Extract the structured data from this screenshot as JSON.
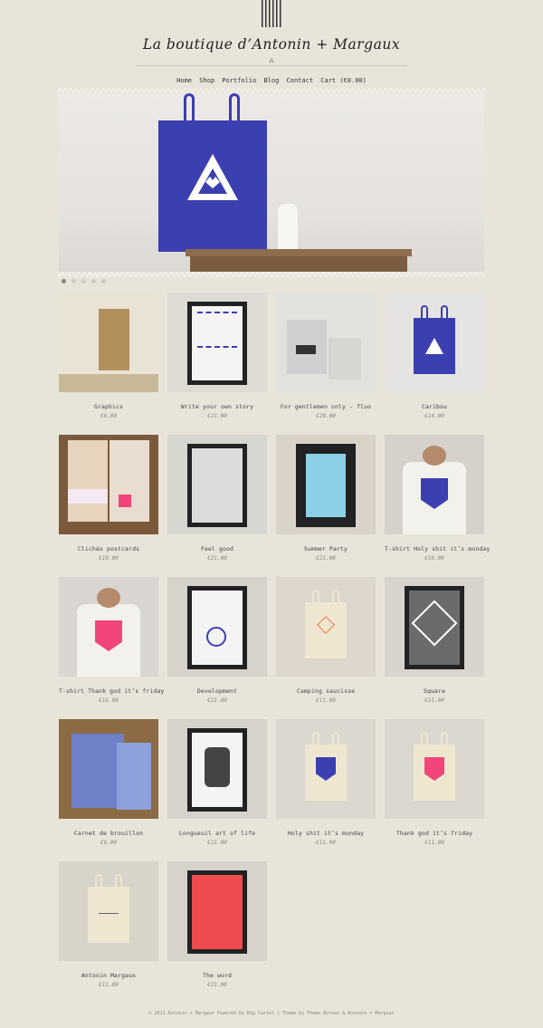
{
  "site": {
    "title": "La boutique d’Antonin + Margaux"
  },
  "nav": [
    {
      "label": "Home"
    },
    {
      "label": "Shop"
    },
    {
      "label": "Portfolio"
    },
    {
      "label": "Blog"
    },
    {
      "label": "Contact"
    },
    {
      "label": "Cart (€0.00)"
    }
  ],
  "slider": {
    "dot_count": 5,
    "active_index": 0
  },
  "products": [
    {
      "name": "Graphics",
      "price": "€6.00",
      "bg": "#e9e3d6"
    },
    {
      "name": "Write your own story",
      "price": "€21.00",
      "bg": "#dedbd4"
    },
    {
      "name": "For gentlemen only - fluo",
      "price": "€29.00",
      "bg": "#e3e1dd"
    },
    {
      "name": "Caribou",
      "price": "€14.00",
      "bg": "#e6e4e2"
    },
    {
      "name": "Clichés postcards",
      "price": "€10.00",
      "bg": "#7a5a3a"
    },
    {
      "name": "Feel good",
      "price": "€21.00",
      "bg": "#d8d6d0"
    },
    {
      "name": "Summer Party",
      "price": "€21.00",
      "bg": "#d9d3c8"
    },
    {
      "name": "T-shirt Holy shit it’s monday",
      "price": "€16.00",
      "bg": "#d6d2cb"
    },
    {
      "name": "T-shirt Thank god it’s friday",
      "price": "€16.00",
      "bg": "#d9d6d1"
    },
    {
      "name": "Development",
      "price": "€21.00",
      "bg": "#d7d2ca"
    },
    {
      "name": "Camping saucisse",
      "price": "€11.00",
      "bg": "#dcd6cc"
    },
    {
      "name": "Square",
      "price": "€21.00",
      "bg": "#d8d4cd"
    },
    {
      "name": "Carnet de brouillon",
      "price": "€6.00",
      "bg": "#8b6a44"
    },
    {
      "name": "Longueuil art of life",
      "price": "€21.00",
      "bg": "#d6d2cc"
    },
    {
      "name": "Holy shit it’s monday",
      "price": "€11.00",
      "bg": "#ddd8cf"
    },
    {
      "name": "Thank god it’s friday",
      "price": "€11.00",
      "bg": "#dbd7cf"
    },
    {
      "name": "Antonin Margaux",
      "price": "€11.00",
      "bg": "#d9d4ca"
    },
    {
      "name": "The word",
      "price": "€21.00",
      "bg": "#d7d3cc"
    }
  ],
  "footer": {
    "text": "© 2011 Antonin + Margaux Powered by Big Cartel | Theme by Theme Bureau & Antonin + Margaux"
  },
  "colors": {
    "background": "#e8e4da",
    "bag_blue": "#3b3fb0",
    "fluo_pink": "#f2457a"
  }
}
